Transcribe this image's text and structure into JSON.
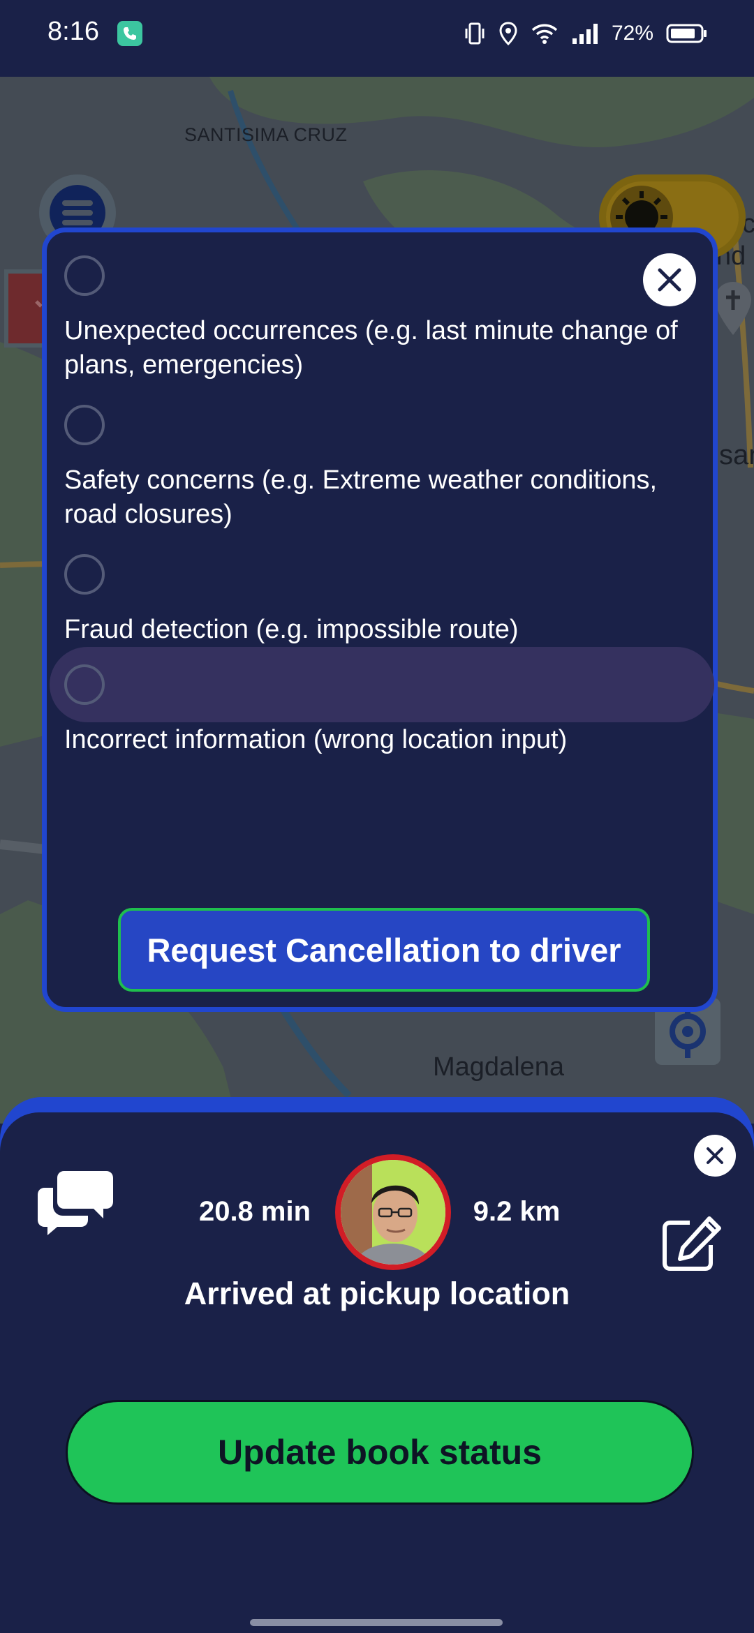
{
  "status_bar": {
    "time": "8:16",
    "battery": "72%",
    "icons": [
      "phone-call-icon",
      "vibrate-icon",
      "location-icon",
      "wifi-icon",
      "signal-icon",
      "battery-icon"
    ]
  },
  "map": {
    "labels": {
      "santisima": "SANTISIMA CRUZ",
      "magdalena": "Magdalena",
      "dioc": "Dioc",
      "nd": "nd",
      "sar": "sar"
    }
  },
  "cancel_modal": {
    "reasons": [
      {
        "label": "Unexpected occurrences (e.g. last minute change of plans, emergencies)",
        "selected": false
      },
      {
        "label": "Safety concerns (e.g. Extreme weather conditions, road closures)",
        "selected": false
      },
      {
        "label": "Fraud detection (e.g. impossible route)",
        "selected": false
      },
      {
        "label": "Incorrect information (wrong location input)",
        "selected": false
      }
    ],
    "request_button": "Request Cancellation to driver"
  },
  "trip": {
    "eta": "20.8 min",
    "distance": "9.2 km",
    "status": "Arrived at pickup location",
    "update_button": "Update book status"
  },
  "colors": {
    "background": "#1a2148",
    "accent_blue": "#2146cf",
    "accent_green": "#1fc458",
    "highlight": "#35315f"
  }
}
